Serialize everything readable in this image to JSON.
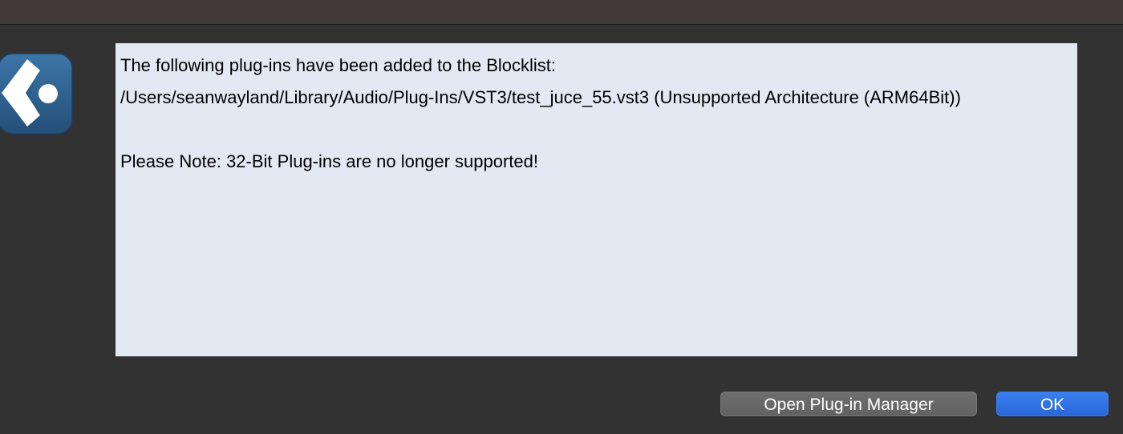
{
  "app": {
    "icon": "cubase-app-icon"
  },
  "message": {
    "lines": [
      "The following plug-ins have been added to the Blocklist:",
      "/Users/seanwayland/Library/Audio/Plug-Ins/VST3/test_juce_55.vst3 (Unsupported Architecture (ARM64Bit))",
      "",
      "Please Note: 32-Bit Plug-ins are no longer supported!"
    ]
  },
  "buttons": {
    "open_manager_label": "Open Plug-in Manager",
    "ok_label": "OK"
  },
  "colors": {
    "background": "#323232",
    "titlebar": "#413838",
    "message_background": "#e3e9f2",
    "ok_button": "#2d6ee3",
    "secondary_button": "#666666",
    "icon_blue": "#2d5f8e"
  }
}
